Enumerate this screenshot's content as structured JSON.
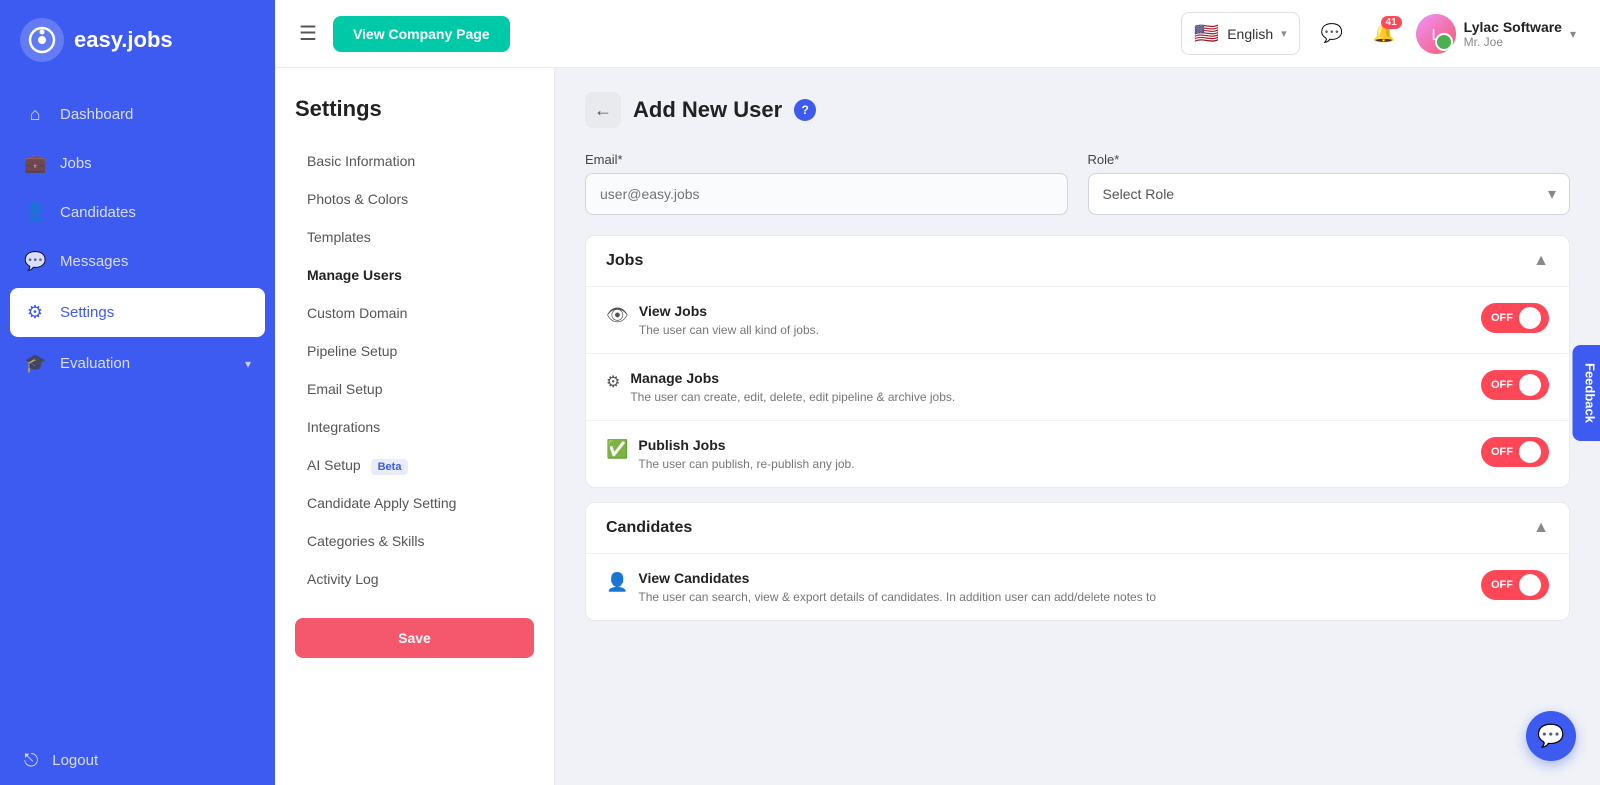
{
  "app": {
    "name": "easy.jobs",
    "logo_letter": "a"
  },
  "sidebar": {
    "nav_items": [
      {
        "id": "dashboard",
        "label": "Dashboard",
        "icon": "⌂"
      },
      {
        "id": "jobs",
        "label": "Jobs",
        "icon": "💼"
      },
      {
        "id": "candidates",
        "label": "Candidates",
        "icon": "👤"
      },
      {
        "id": "messages",
        "label": "Messages",
        "icon": "💬"
      },
      {
        "id": "settings",
        "label": "Settings",
        "icon": "⚙"
      },
      {
        "id": "evaluation",
        "label": "Evaluation",
        "icon": "🎓"
      }
    ],
    "logout_label": "Logout"
  },
  "header": {
    "view_company_btn": "View Company Page",
    "language": "English",
    "notification_count": "41",
    "user_name": "Lylac Software",
    "user_sub": "Mr. Joe"
  },
  "settings_menu": {
    "title": "Settings",
    "items": [
      {
        "id": "basic-information",
        "label": "Basic Information",
        "active": false
      },
      {
        "id": "photos-colors",
        "label": "Photos & Colors",
        "active": false
      },
      {
        "id": "templates",
        "label": "Templates",
        "active": false
      },
      {
        "id": "manage-users",
        "label": "Manage Users",
        "active": true
      },
      {
        "id": "custom-domain",
        "label": "Custom Domain",
        "active": false
      },
      {
        "id": "pipeline-setup",
        "label": "Pipeline Setup",
        "active": false
      },
      {
        "id": "email-setup",
        "label": "Email Setup",
        "active": false
      },
      {
        "id": "integrations",
        "label": "Integrations",
        "active": false
      },
      {
        "id": "ai-setup",
        "label": "AI Setup",
        "active": false,
        "badge": "Beta"
      },
      {
        "id": "candidate-apply-setting",
        "label": "Candidate Apply Setting",
        "active": false
      },
      {
        "id": "categories-skills",
        "label": "Categories & Skills",
        "active": false
      },
      {
        "id": "activity-log",
        "label": "Activity Log",
        "active": false
      }
    ]
  },
  "page": {
    "title": "Add New User",
    "email_label": "Email*",
    "email_placeholder": "user@easy.jobs",
    "role_label": "Role*",
    "role_placeholder": "Select Role"
  },
  "permissions": {
    "jobs_section": {
      "title": "Jobs",
      "items": [
        {
          "id": "view-jobs",
          "icon": "👁",
          "title": "View Jobs",
          "description": "The user can view all kind of jobs.",
          "toggle": "OFF"
        },
        {
          "id": "manage-jobs",
          "icon": "⚙",
          "title": "Manage Jobs",
          "description": "The user can create, edit, delete, edit pipeline & archive jobs.",
          "toggle": "OFF"
        },
        {
          "id": "publish-jobs",
          "icon": "✅",
          "title": "Publish Jobs",
          "description": "The user can publish, re-publish any job.",
          "toggle": "OFF"
        }
      ]
    },
    "candidates_section": {
      "title": "Candidates",
      "items": [
        {
          "id": "view-candidates",
          "icon": "👤",
          "title": "View Candidates",
          "description": "The user can search, view & export details of candidates. In addition user can add/delete notes to",
          "toggle": "OFF"
        }
      ]
    }
  },
  "feedback_btn": "Feedback"
}
